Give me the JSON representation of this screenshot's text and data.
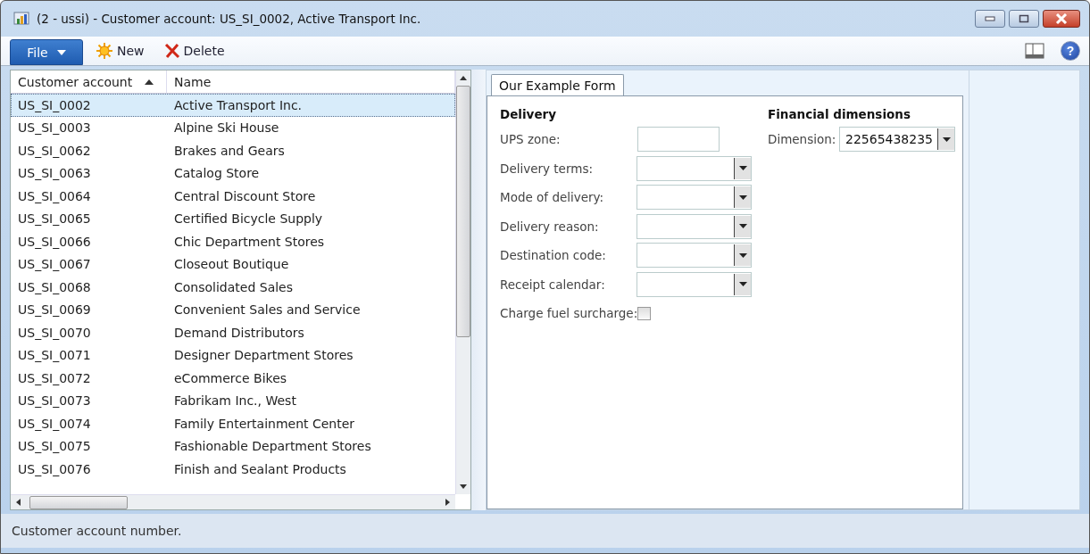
{
  "window": {
    "title": "(2 - ussi) - Customer account: US_SI_0002, Active Transport Inc."
  },
  "toolbar": {
    "file_menu": "File",
    "help": "?",
    "buttons": [
      {
        "label": "New",
        "kind": "new"
      },
      {
        "label": "Delete",
        "kind": "delete"
      }
    ]
  },
  "grid": {
    "columns": [
      {
        "label": "Customer account",
        "sorted": true
      },
      {
        "label": "Name",
        "sorted": false
      }
    ],
    "rows": [
      {
        "account": "US_SI_0002",
        "name": "Active Transport Inc.",
        "selected": true
      },
      {
        "account": "US_SI_0003",
        "name": "Alpine Ski House",
        "selected": false
      },
      {
        "account": "US_SI_0062",
        "name": "Brakes and Gears",
        "selected": false
      },
      {
        "account": "US_SI_0063",
        "name": "Catalog Store",
        "selected": false
      },
      {
        "account": "US_SI_0064",
        "name": "Central Discount Store",
        "selected": false
      },
      {
        "account": "US_SI_0065",
        "name": "Certified Bicycle Supply",
        "selected": false
      },
      {
        "account": "US_SI_0066",
        "name": "Chic Department Stores",
        "selected": false
      },
      {
        "account": "US_SI_0067",
        "name": "Closeout Boutique",
        "selected": false
      },
      {
        "account": "US_SI_0068",
        "name": "Consolidated Sales",
        "selected": false
      },
      {
        "account": "US_SI_0069",
        "name": "Convenient Sales and Service",
        "selected": false
      },
      {
        "account": "US_SI_0070",
        "name": "Demand Distributors",
        "selected": false
      },
      {
        "account": "US_SI_0071",
        "name": "Designer Department Stores",
        "selected": false
      },
      {
        "account": "US_SI_0072",
        "name": "eCommerce Bikes",
        "selected": false
      },
      {
        "account": "US_SI_0073",
        "name": "Fabrikam Inc., West",
        "selected": false
      },
      {
        "account": "US_SI_0074",
        "name": "Family Entertainment Center",
        "selected": false
      },
      {
        "account": "US_SI_0075",
        "name": "Fashionable Department Stores",
        "selected": false
      },
      {
        "account": "US_SI_0076",
        "name": "Finish and Sealant Products",
        "selected": false
      }
    ]
  },
  "form": {
    "tabs": [
      {
        "label": "Our Example Form",
        "selected": true
      }
    ],
    "delivery": {
      "heading": "Delivery",
      "fields": [
        {
          "label": "UPS zone:",
          "kind": "text"
        },
        {
          "label": "Delivery terms:",
          "kind": "combo"
        },
        {
          "label": "Mode of delivery:",
          "kind": "combo"
        },
        {
          "label": "Delivery reason:",
          "kind": "combo"
        },
        {
          "label": "Destination code:",
          "kind": "combo"
        },
        {
          "label": "Receipt calendar:",
          "kind": "combo"
        },
        {
          "label": "Charge fuel surcharge:",
          "kind": "checkbox",
          "checked": false
        }
      ]
    },
    "financial": {
      "heading": "Financial dimensions",
      "fields": [
        {
          "label": "Dimension:",
          "kind": "combo",
          "value": "22565438235"
        }
      ]
    }
  },
  "status_bar": {
    "text": "Customer account number."
  }
}
